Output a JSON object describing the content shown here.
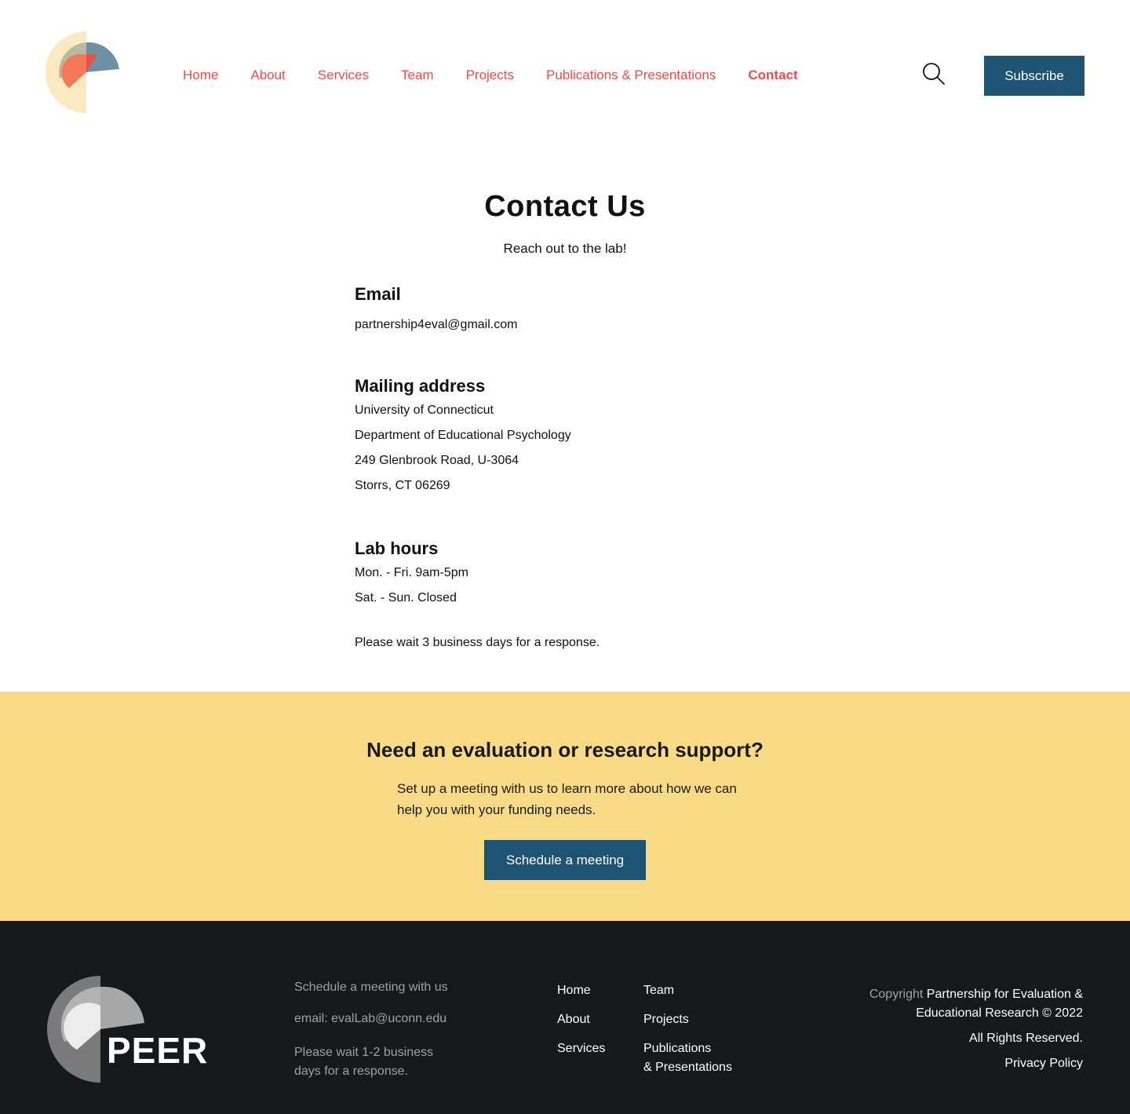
{
  "header": {
    "nav": [
      {
        "label": "Home"
      },
      {
        "label": "About"
      },
      {
        "label": "Services"
      },
      {
        "label": "Team"
      },
      {
        "label": "Projects"
      },
      {
        "label": "Publications & Presentations"
      },
      {
        "label": "Contact",
        "active": true
      }
    ],
    "subscribe_label": "Subscribe",
    "search_icon": "search-icon",
    "accent_color": "#e84c4c",
    "button_color": "#1f5373"
  },
  "contact": {
    "title": "Contact Us",
    "subtitle": "Reach out to the lab!",
    "email_heading": "Email",
    "email": "partnership4eval@gmail.com",
    "mailing_heading": "Mailing address",
    "address": [
      "University of Connecticut",
      "Department of Educational Psychology",
      "249 Glenbrook Road, U-3064",
      "Storrs, CT 06269"
    ],
    "hours_heading": "Lab hours",
    "hours": [
      "Mon. - Fri. 9am-5pm",
      "Sat. - Sun. Closed"
    ],
    "wait_note": "Please wait 3 business days for a response."
  },
  "cta": {
    "heading": "Need an evaluation or research support?",
    "text": "Set up a meeting with us to learn more about how we can help you with your funding needs.",
    "button_label": "Schedule a meeting",
    "background": "#f9da87"
  },
  "footer": {
    "brand": "PEER",
    "schedule": "Schedule a meeting with us",
    "email": "email: evalLab@uconn.edu",
    "wait": "Please wait 1-2 business days for a response.",
    "links_col1": [
      "Home",
      "About",
      "Services"
    ],
    "links_col2": [
      "Team",
      "Projects",
      "Publications",
      "& Presentations"
    ],
    "copyright_prefix": "Copyright",
    "copyright_line1": "Partnership for Evaluation &",
    "copyright_line2": "Educational Research © 2022",
    "rights": "All Rights Reserved.",
    "privacy": "Privacy Policy",
    "background": "#16191c"
  }
}
